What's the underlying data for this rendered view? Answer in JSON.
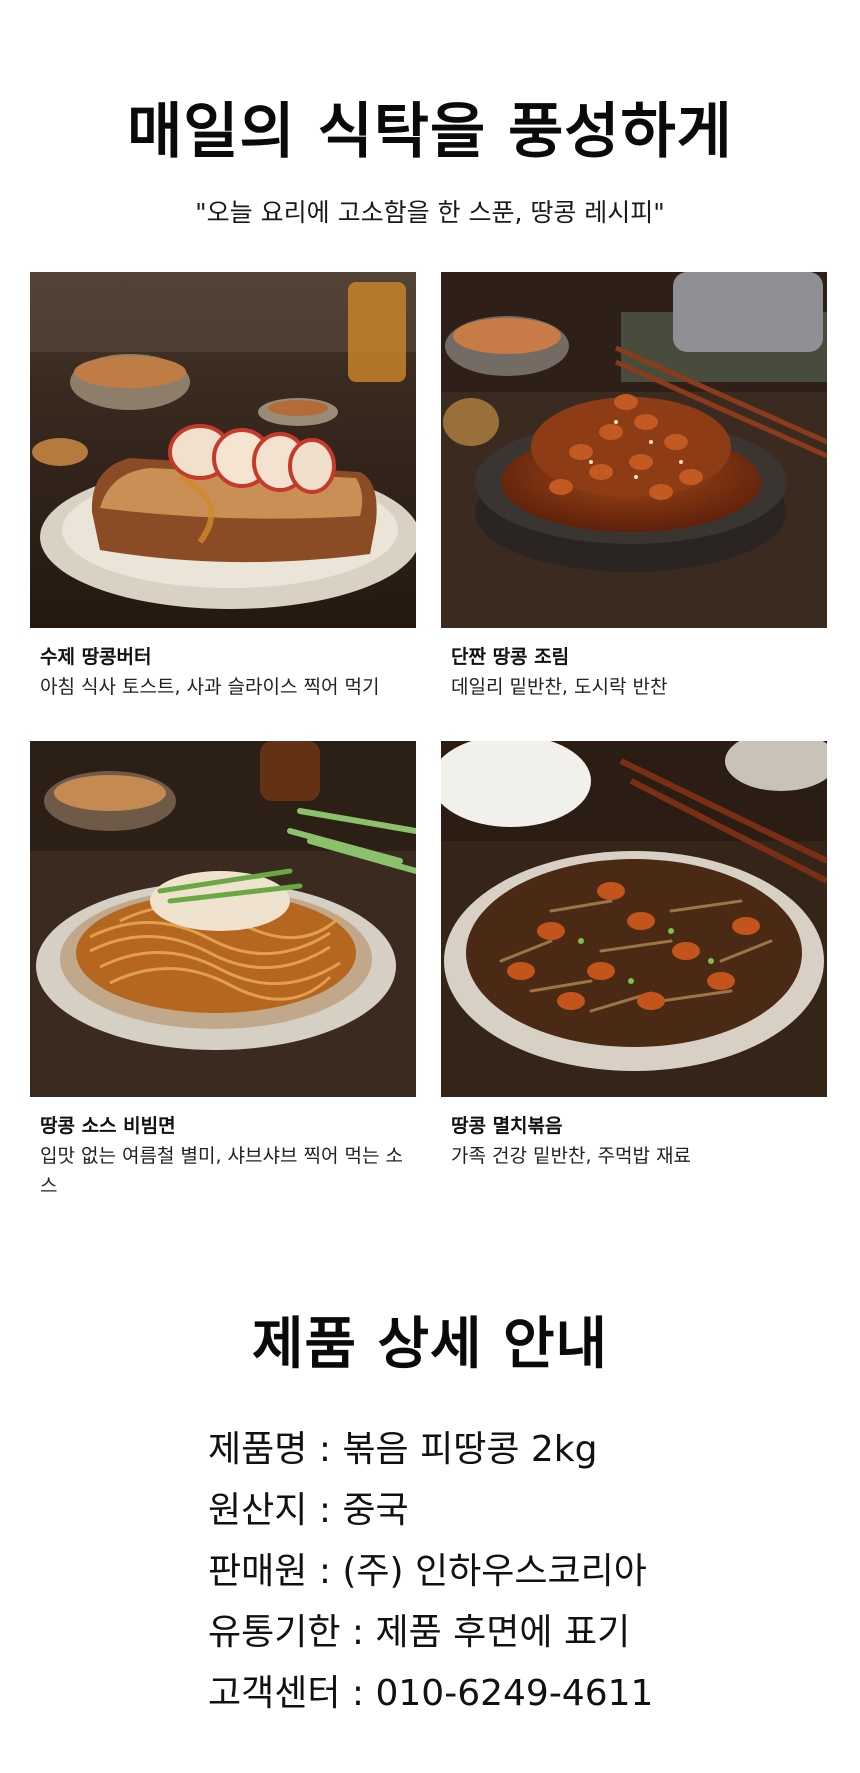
{
  "section1": {
    "title": "매일의 식탁을 풍성하게",
    "subtitle": "\"오늘 요리에 고소함을 한 스푼, 땅콩 레시피\""
  },
  "recipes": [
    {
      "title": "수제 땅콩버터",
      "desc": "아침 식사 토스트, 사과 슬라이스 찍어 먹기",
      "icon": "peanut-butter-toast-photo"
    },
    {
      "title": "단짠 땅콩 조림",
      "desc": "데일리 밑반찬, 도시락 반찬",
      "icon": "braised-peanuts-photo"
    },
    {
      "title": "땅콩 소스 비빔면",
      "desc": "입맛 없는 여름철 별미, 샤브샤브 찍어 먹는 소스",
      "icon": "peanut-sauce-noodles-photo"
    },
    {
      "title": "땅콩 멸치볶음",
      "desc": "가족 건강 밑반찬, 주먹밥 재료",
      "icon": "anchovy-peanut-stirfry-photo"
    }
  ],
  "section2": {
    "title": "제품 상세 안내",
    "specs": [
      {
        "key": "제품명",
        "value": "볶음 피땅콩 2kg"
      },
      {
        "key": "원산지",
        "value": "중국"
      },
      {
        "key": "판매원",
        "value": "(주) 인하우스코리아"
      },
      {
        "key": "유통기한",
        "value": "제품 후면에 표기"
      },
      {
        "key": "고객센터",
        "value": "010-6249-4611"
      }
    ]
  },
  "colors": {
    "wood": "#3b2a1f",
    "plate": "#e7e0d6",
    "peanut": "#9b4a1c",
    "noodle": "#c98a3e"
  }
}
